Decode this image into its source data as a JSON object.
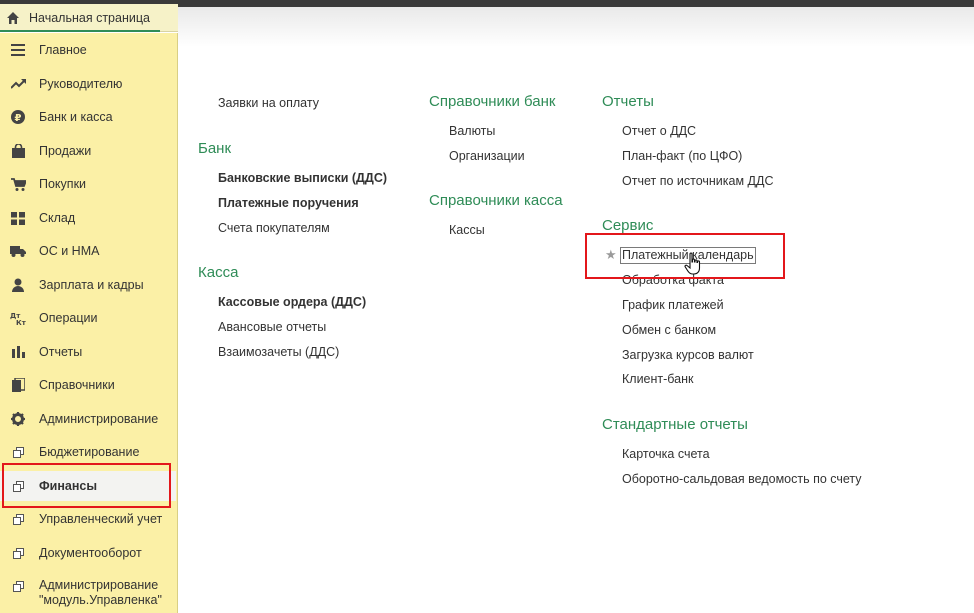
{
  "home": {
    "label": "Начальная страница",
    "icon": "home-icon"
  },
  "sidebar": {
    "items": [
      {
        "label": "Главное",
        "icon": "menu-lines-icon"
      },
      {
        "label": "Руководителю",
        "icon": "trend-up-icon"
      },
      {
        "label": "Банк и касса",
        "icon": "ruble-coin-icon"
      },
      {
        "label": "Продажи",
        "icon": "shopping-bag-icon"
      },
      {
        "label": "Покупки",
        "icon": "shopping-cart-icon"
      },
      {
        "label": "Склад",
        "icon": "grid-warehouse-icon"
      },
      {
        "label": "ОС и НМА",
        "icon": "truck-icon"
      },
      {
        "label": "Зарплата и кадры",
        "icon": "person-icon"
      },
      {
        "label": "Операции",
        "icon": "dt-kt-icon"
      },
      {
        "label": "Отчеты",
        "icon": "bar-chart-icon"
      },
      {
        "label": "Справочники",
        "icon": "books-icon"
      },
      {
        "label": "Администрирование",
        "icon": "gear-icon"
      },
      {
        "label": "Бюджетирование",
        "icon": "subsystem-icon"
      },
      {
        "label": "Финансы",
        "icon": "subsystem-icon"
      },
      {
        "label": "Управленческий учет",
        "icon": "subsystem-icon"
      },
      {
        "label": "Документооборот",
        "icon": "subsystem-icon"
      },
      {
        "label": "Администрирование\n\"модуль.Управленка\"",
        "icon": "subsystem-icon"
      }
    ]
  },
  "content": {
    "col1": {
      "top_link": "Заявки на оплату",
      "bank_title": "Банк",
      "bank_links": [
        "Банковские выписки (ДДС)",
        "Платежные поручения",
        "Счета покупателям"
      ],
      "kassa_title": "Касса",
      "kassa_links": [
        "Кассовые ордера (ДДС)",
        "Авансовые отчеты",
        "Взаимозачеты (ДДС)"
      ]
    },
    "col2": {
      "ref_bank_title": "Справочники банк",
      "ref_bank_links": [
        "Валюты",
        "Организации"
      ],
      "ref_kassa_title": "Справочники касса",
      "ref_kassa_links": [
        "Кассы"
      ]
    },
    "col3": {
      "reports_title": "Отчеты",
      "reports_links": [
        "Отчет о ДДС",
        "План-факт (по ЦФО)",
        "Отчет по источникам ДДС"
      ],
      "service_title": "Сервис",
      "service_highlight": "Платежный календарь",
      "service_links": [
        "Обработка факта",
        "График платежей",
        "Обмен с банком",
        "Загрузка курсов валют",
        "Клиент-банк"
      ],
      "std_title": "Стандартные отчеты",
      "std_links": [
        "Карточка счета",
        "Оборотно-сальдовая ведомость по счету"
      ]
    }
  },
  "colors": {
    "accent_green": "#2f8c57",
    "sidebar_bg": "#fbf0a6",
    "red_box": "#e3171b"
  }
}
